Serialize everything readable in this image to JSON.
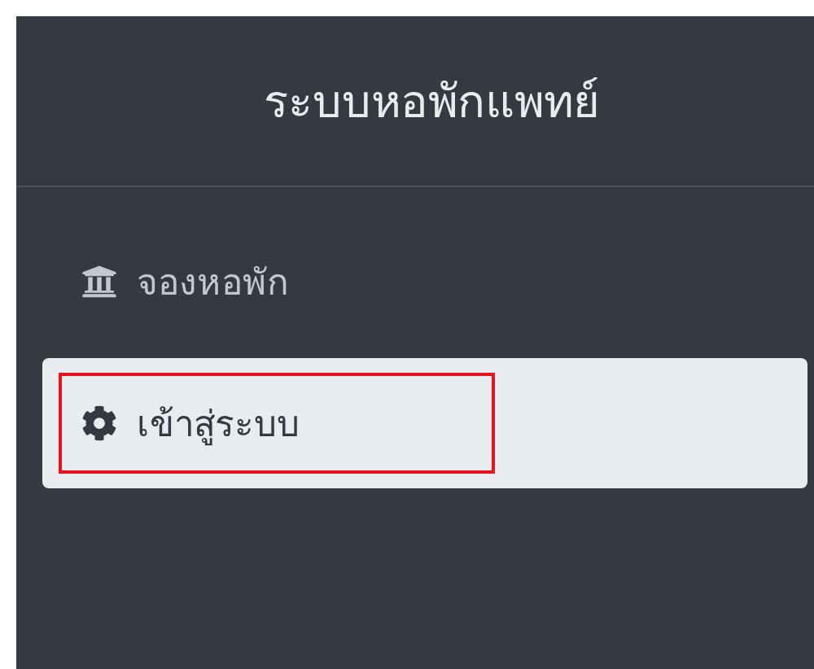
{
  "sidebar": {
    "title": "ระบบหอพักแพทย์",
    "items": [
      {
        "label": "จองหอพัก",
        "selected": false,
        "highlighted": false
      },
      {
        "label": "เข้าสู่ระบบ",
        "selected": true,
        "highlighted": true
      }
    ]
  }
}
